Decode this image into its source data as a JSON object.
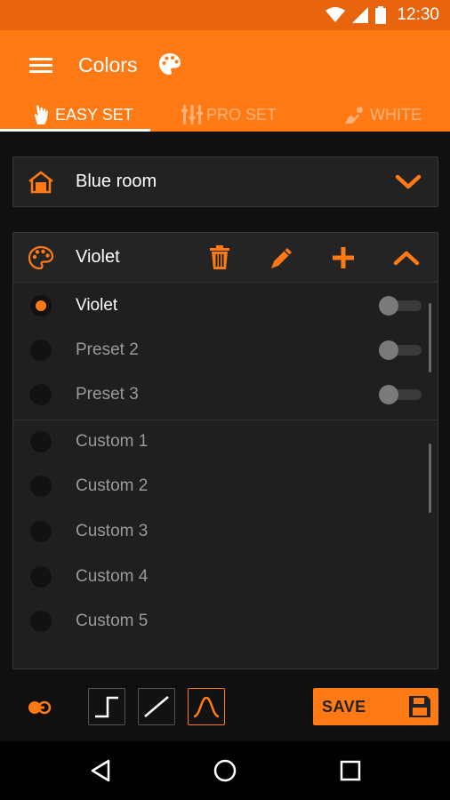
{
  "status_bar": {
    "time": "12:30"
  },
  "app_bar": {
    "title": "Colors"
  },
  "tabs": [
    {
      "label": "EASY SET",
      "active": true
    },
    {
      "label": "PRO SET",
      "active": false
    },
    {
      "label": "WHITE",
      "active": false
    }
  ],
  "room": {
    "name": "Blue room"
  },
  "preset_panel": {
    "title": "Violet",
    "presets": [
      {
        "label": "Violet",
        "selected": true,
        "toggle_on": false
      },
      {
        "label": "Preset 2",
        "selected": false,
        "toggle_on": false
      },
      {
        "label": "Preset 3",
        "selected": false,
        "toggle_on": false
      }
    ],
    "custom": [
      {
        "label": "Custom 1",
        "selected": false
      },
      {
        "label": "Custom 2",
        "selected": false
      },
      {
        "label": "Custom 3",
        "selected": false
      },
      {
        "label": "Custom 4",
        "selected": false
      },
      {
        "label": "Custom 5",
        "selected": false
      }
    ]
  },
  "bottom_toolbar": {
    "save_label": "SAVE",
    "curves": [
      "step-curve-icon",
      "linear-curve-icon",
      "bell-curve-icon"
    ],
    "active_curve": "bell-curve-icon"
  },
  "icons": {
    "menu": "hamburger-menu-icon",
    "title": "palette-icon",
    "room": "house-icon",
    "room_expand": "chevron-down-icon",
    "panel_collapse": "chevron-up-icon",
    "delete": "trash-icon",
    "edit": "pencil-icon",
    "add": "plus-icon",
    "link": "link-toggle-icon",
    "save": "floppy-disk-icon"
  },
  "colors": {
    "accent": "#ff7a15",
    "status_bar": "#e8650d",
    "background": "#101010",
    "panel": "#1f1f1f",
    "tab_inactive": "#ffb27a"
  }
}
